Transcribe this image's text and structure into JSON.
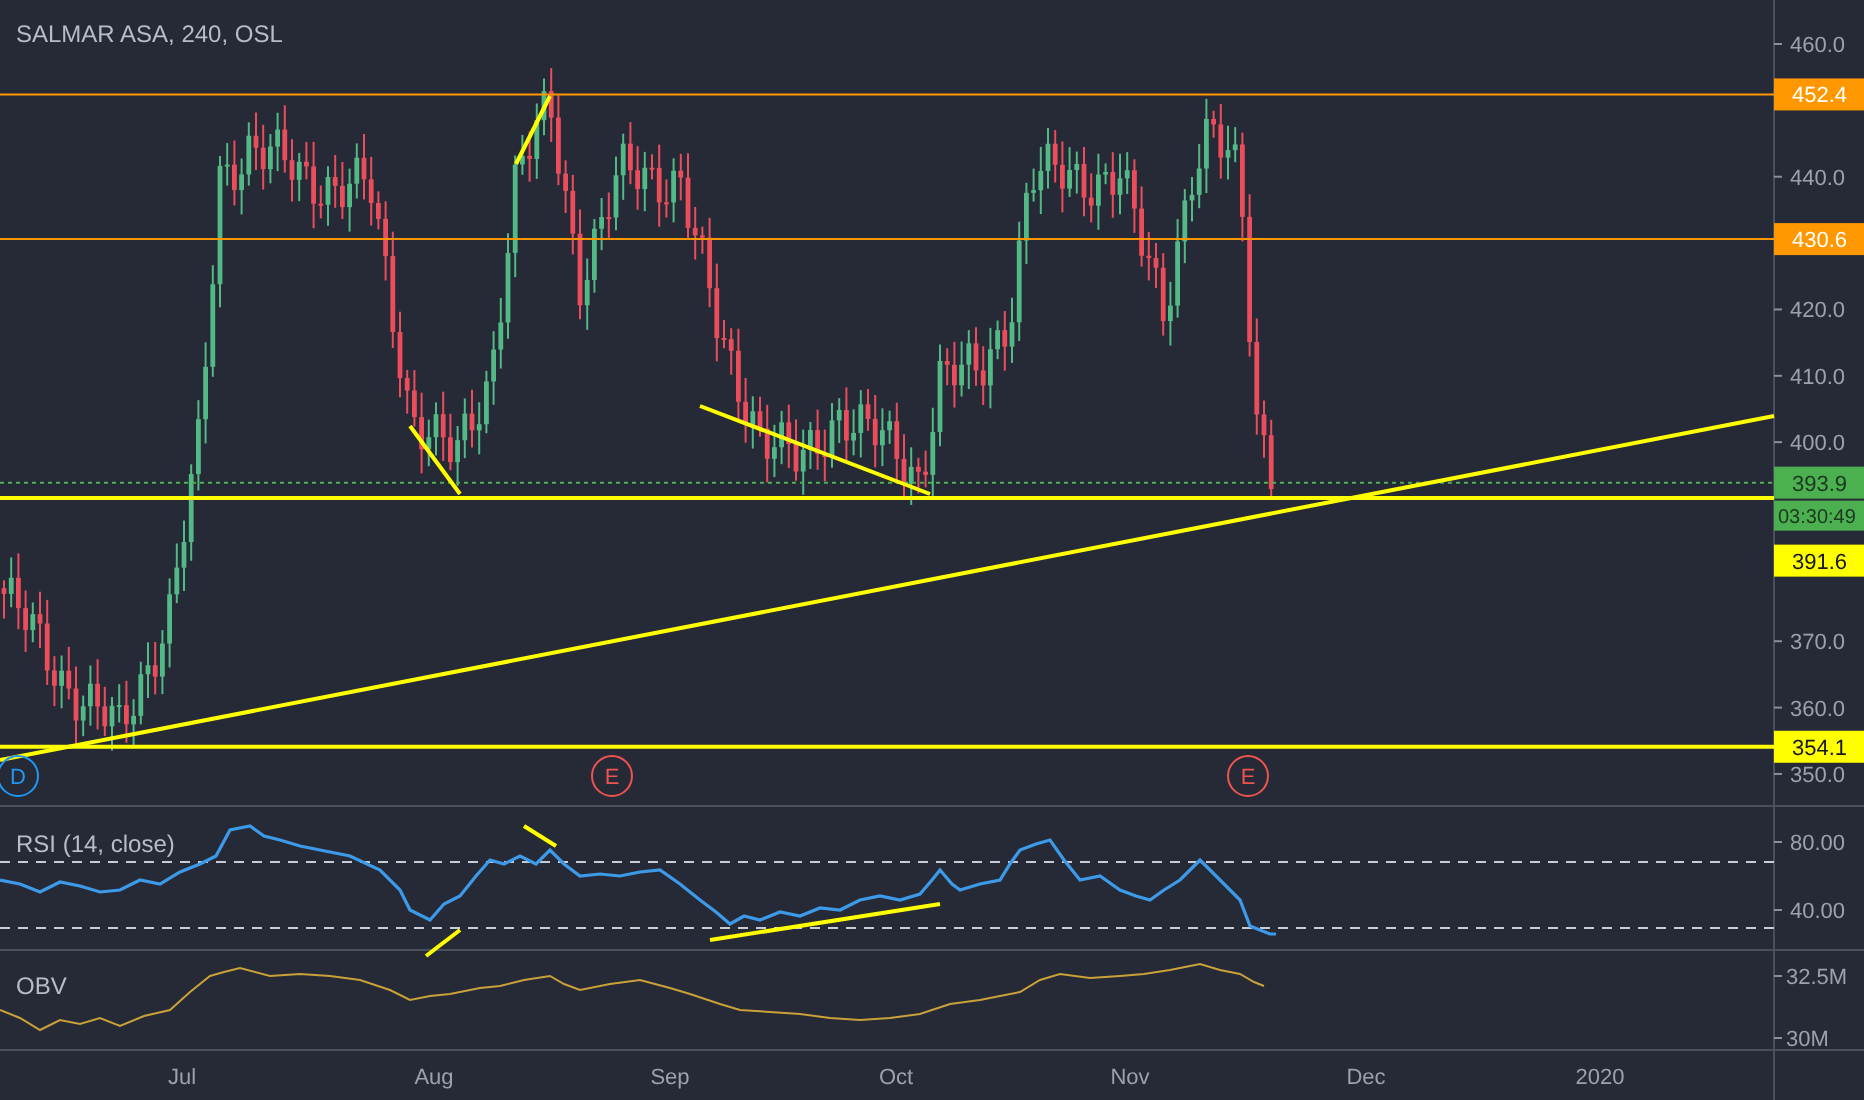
{
  "title": "SALMAR ASA, 240, OSL",
  "price_axis": {
    "labels": [
      "460.0",
      "440.0",
      "420.0",
      "410.0",
      "400.0",
      "370.0",
      "360.0",
      "350.0"
    ]
  },
  "price_tags": [
    {
      "text": "452.4",
      "color": "#ff9800",
      "kind": "solid"
    },
    {
      "text": "430.6",
      "color": "#ff9800",
      "kind": "solid"
    },
    {
      "text": "393.9",
      "color": "#4caf50",
      "kind": "dotted",
      "countdown": "03:30:49"
    },
    {
      "text": "391.6",
      "color": "#ffff00",
      "kind": "solid"
    },
    {
      "text": "354.1",
      "color": "#ffff00",
      "kind": "solid"
    }
  ],
  "events": [
    {
      "text": "D",
      "color": "#2196f3"
    },
    {
      "text": "E",
      "color": "#ef5350"
    },
    {
      "text": "E",
      "color": "#ef5350"
    }
  ],
  "rsi": {
    "label": "RSI (14, close)",
    "axis_labels": [
      "80.00",
      "40.00"
    ]
  },
  "obv": {
    "label": "OBV",
    "axis_labels": [
      "32.5M",
      "30M"
    ]
  },
  "time_axis": {
    "labels": [
      "Jul",
      "Aug",
      "Sep",
      "Oct",
      "Nov",
      "Dec",
      "2020"
    ]
  }
}
